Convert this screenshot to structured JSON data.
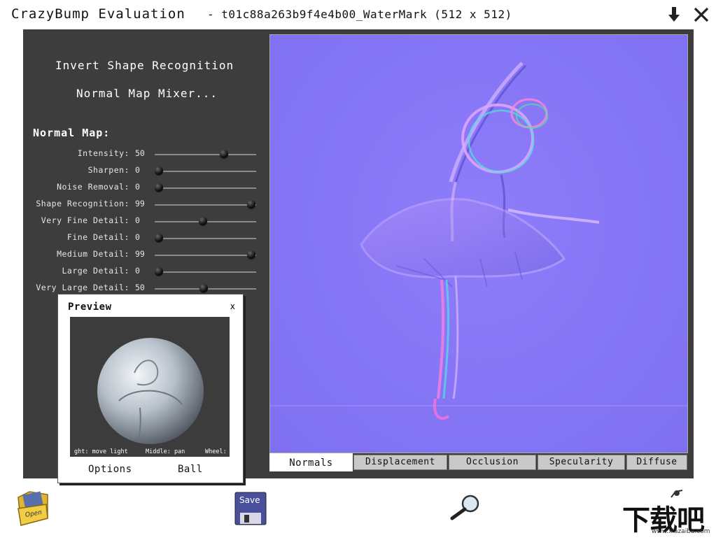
{
  "window": {
    "app_title": "CrazyBump Evaluation",
    "file_title": "- t01c88a263b9f4e4b00_WaterMark (512 x 512)"
  },
  "sidebar": {
    "invert_label": "Invert Shape Recognition",
    "mixer_label": "Normal Map Mixer...",
    "section_title": "Normal Map:",
    "sliders": [
      {
        "label": "Intensity:",
        "value": "50",
        "level": 0.7
      },
      {
        "label": "Sharpen:",
        "value": "0",
        "level": 0.0
      },
      {
        "label": "Noise Removal:",
        "value": "0",
        "level": 0.0
      },
      {
        "label": "Shape Recognition:",
        "value": "99",
        "level": 0.99
      },
      {
        "label": "Very Fine Detail:",
        "value": "0",
        "level": 0.47
      },
      {
        "label": "Fine Detail:",
        "value": "0",
        "level": 0.0
      },
      {
        "label": "Medium Detail:",
        "value": "99",
        "level": 0.99
      },
      {
        "label": "Large Detail:",
        "value": "0",
        "level": 0.0
      },
      {
        "label": "Very Large Detail:",
        "value": "50",
        "level": 0.48
      }
    ]
  },
  "preview": {
    "title": "Preview",
    "close": "x",
    "hint_left": "ght: move light",
    "hint_middle": "Middle: pan",
    "hint_right": "Wheel:",
    "options_label": "Options",
    "ball_label": "Ball"
  },
  "tabs": [
    {
      "label": "Normals",
      "active": true
    },
    {
      "label": "Displacement",
      "active": false
    },
    {
      "label": "Occlusion",
      "active": false
    },
    {
      "label": "Specularity",
      "active": false
    },
    {
      "label": "Diffuse",
      "active": false
    }
  ],
  "toolbar": {
    "open_label": "Open",
    "save_label": "Save"
  },
  "watermark": {
    "brand": "下载吧",
    "url": "www.xiazaiba.com"
  },
  "colors": {
    "panel": "#3d3d3d",
    "normal_map_base": "#8475f5",
    "tab_inactive": "#c9c9c9",
    "tab_active": "#ffffff"
  },
  "icons": [
    "download-arrow-icon",
    "close-x-icon",
    "open-folder-icon",
    "save-floppy-icon",
    "magnifier-icon"
  ]
}
